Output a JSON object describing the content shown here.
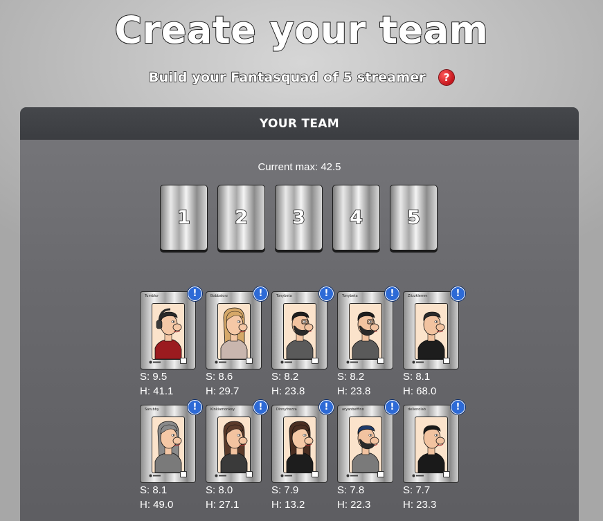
{
  "page": {
    "title": "Create your team",
    "subtitle": "Build your Fantasquad of 5 streamer",
    "help_icon_glyph": "?"
  },
  "team_panel": {
    "title": "YOUR TEAM",
    "current_max": "Current max: 42.5",
    "slots": [
      {
        "label": "1"
      },
      {
        "label": "2"
      },
      {
        "label": "3"
      },
      {
        "label": "4"
      },
      {
        "label": "5"
      }
    ]
  },
  "colors": {
    "info_badge": "#2d6ad6",
    "help_badge": "#c4151c",
    "panel_header": "#3f4145",
    "panel_body": "#6a6a6e"
  },
  "players": [
    {
      "card_name": "Tumblur",
      "hair": "#2a2a2a",
      "shirt": "#9b1b1f",
      "skin": "#f5c8a6",
      "long_hair": false,
      "headphones": true,
      "beard": false,
      "glasses": false,
      "score": "S: 9.5",
      "history": "H: 41.1"
    },
    {
      "card_name": "Bobbalorz",
      "hair": "#d6a868",
      "shirt": "#c9b6ae",
      "skin": "#f5c8a6",
      "long_hair": true,
      "headphones": false,
      "beard": false,
      "glasses": false,
      "score": "S: 8.6",
      "history": "H: 29.7"
    },
    {
      "card_name": "Tonybeta",
      "hair": "#1e1e1e",
      "shirt": "#5a5a5a",
      "skin": "#f2c3a0",
      "long_hair": false,
      "headphones": false,
      "beard": true,
      "glasses": true,
      "score": "S: 8.2",
      "history": "H: 23.8"
    },
    {
      "card_name": "Tonybeta",
      "hair": "#1e1e1e",
      "shirt": "#5a5a5a",
      "skin": "#f2c3a0",
      "long_hair": false,
      "headphones": false,
      "beard": true,
      "glasses": true,
      "score": "S: 8.2",
      "history": "H: 23.8"
    },
    {
      "card_name": "Ziizzklemm",
      "hair": "#2b2b2b",
      "shirt": "#1d1d1d",
      "skin": "#f2c3a0",
      "long_hair": false,
      "headphones": false,
      "beard": false,
      "glasses": false,
      "score": "S: 8.1",
      "history": "H: 68.0"
    },
    {
      "card_name": "Sarubby",
      "hair": "#8a8a8a",
      "shirt": "#7a7a7a",
      "skin": "#f5c8a6",
      "long_hair": true,
      "headphones": false,
      "beard": false,
      "glasses": false,
      "score": "S: 8.1",
      "history": "H: 49.0"
    },
    {
      "card_name": "Kinkiamonkey",
      "hair": "#5a3a2a",
      "shirt": "#3a3a3a",
      "skin": "#f2c3a0",
      "long_hair": true,
      "headphones": false,
      "beard": false,
      "glasses": false,
      "score": "S: 8.0",
      "history": "H: 27.1"
    },
    {
      "card_name": "Dinnyfrezza",
      "hair": "#4a2e22",
      "shirt": "#1d1d1d",
      "skin": "#f5c8a6",
      "long_hair": true,
      "headphones": false,
      "beard": false,
      "glasses": false,
      "score": "S: 7.9",
      "history": "H: 13.2"
    },
    {
      "card_name": "aryanbeffino",
      "hair": "#1d3a6a",
      "shirt": "#7a7a7a",
      "skin": "#f2c3a0",
      "long_hair": false,
      "headphones": false,
      "beard": true,
      "glasses": false,
      "score": "S: 7.8",
      "history": "H: 22.3"
    },
    {
      "card_name": "delienolab",
      "hair": "#1a1a1a",
      "shirt": "#1a1a1a",
      "skin": "#f2c3a0",
      "long_hair": false,
      "headphones": false,
      "beard": false,
      "glasses": false,
      "score": "S: 7.7",
      "history": "H: 23.3"
    }
  ]
}
